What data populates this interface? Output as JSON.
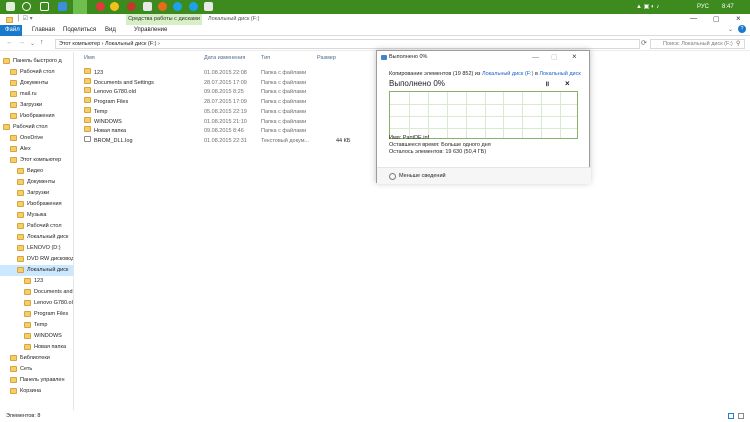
{
  "taskbar": {
    "lang": "РУС",
    "time": "8:47"
  },
  "ribbon": {
    "context_tab": "Средства работы с дисками",
    "window_title": "Локальный диск (F:)",
    "tabs": [
      "Файл",
      "Главная",
      "Поделиться",
      "Вид",
      "Управление"
    ]
  },
  "address": {
    "path": "Этот компьютер  ›  Локальный диск (F:)  ›",
    "search_placeholder": "Поиск: Локальный диск (F:)"
  },
  "nav": [
    {
      "label": "Панель быстрого д",
      "indent": 0
    },
    {
      "label": "Рабочий стол",
      "indent": 1
    },
    {
      "label": "Документы",
      "indent": 1
    },
    {
      "label": "mail.ru",
      "indent": 1
    },
    {
      "label": "Загрузки",
      "indent": 1
    },
    {
      "label": "Изображения",
      "indent": 1
    },
    {
      "label": "Рабочий стол",
      "indent": 0
    },
    {
      "label": "OneDrive",
      "indent": 1
    },
    {
      "label": "Alex",
      "indent": 1
    },
    {
      "label": "Этот компьютер",
      "indent": 1
    },
    {
      "label": "Видео",
      "indent": 2
    },
    {
      "label": "Документы",
      "indent": 2
    },
    {
      "label": "Загрузки",
      "indent": 2
    },
    {
      "label": "Изображения",
      "indent": 2
    },
    {
      "label": "Музыка",
      "indent": 2
    },
    {
      "label": "Рабочий стол",
      "indent": 2
    },
    {
      "label": "Локальный диск",
      "indent": 2
    },
    {
      "label": "LENOVO (D:)",
      "indent": 2
    },
    {
      "label": "DVD RW дисковод",
      "indent": 2
    },
    {
      "label": "Локальный диск",
      "indent": 2
    },
    {
      "label": "123",
      "indent": 3
    },
    {
      "label": "Documents and",
      "indent": 3
    },
    {
      "label": "Lenovo G780.old",
      "indent": 3
    },
    {
      "label": "Program Files",
      "indent": 3
    },
    {
      "label": "Temp",
      "indent": 3
    },
    {
      "label": "WINDOWS",
      "indent": 3
    },
    {
      "label": "Новая папка",
      "indent": 3
    },
    {
      "label": "Библиотеки",
      "indent": 1
    },
    {
      "label": "Сеть",
      "indent": 1
    },
    {
      "label": "Панель управлен",
      "indent": 1
    },
    {
      "label": "Корзина",
      "indent": 1
    }
  ],
  "columns": [
    "Имя",
    "Дата изменения",
    "Тип",
    "Размер"
  ],
  "files": [
    {
      "name": "123",
      "date": "01.08.2015 22:08",
      "type": "Папка с файлами",
      "size": ""
    },
    {
      "name": "Documents and Settings",
      "date": "28.07.2015 17:09",
      "type": "Папка с файлами",
      "size": ""
    },
    {
      "name": "Lenovo G780.old",
      "date": "09.08.2015 8:25",
      "type": "Папка с файлами",
      "size": ""
    },
    {
      "name": "Program Files",
      "date": "28.07.2015 17:09",
      "type": "Папка с файлами",
      "size": ""
    },
    {
      "name": "Temp",
      "date": "05.08.2015 22:19",
      "type": "Папка с файлами",
      "size": ""
    },
    {
      "name": "WINDOWS",
      "date": "01.08.2015 21:10",
      "type": "Папка с файлами",
      "size": ""
    },
    {
      "name": "Новая папка",
      "date": "09.08.2015 8:46",
      "type": "Папка с файлами",
      "size": ""
    },
    {
      "name": "BROM_DLL.log",
      "date": "01.08.2015 22:31",
      "type": "Текстовый докум...",
      "size": "44 КБ"
    }
  ],
  "status": {
    "items": "Элементов: 8"
  },
  "dialog": {
    "title": "Выполнено 0%",
    "copy_prefix": "Копирование элементов (19 852) из",
    "copy_from": "Локальный диск (F:)",
    "copy_mid": "в",
    "copy_to": "Локальный диск",
    "percent": "Выполнено 0%",
    "progress": 0,
    "name_line": "Имя: PantDE.inf",
    "time_line": "Оставшееся время: Больше одного дня",
    "left_line": "Осталось элементов: 19 630 (50,4 ГБ)",
    "less_details": "Меньше сведений"
  }
}
